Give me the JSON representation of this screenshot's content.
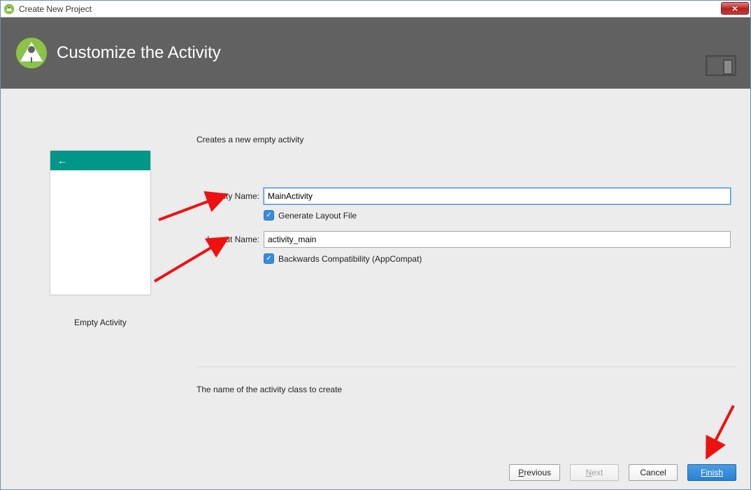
{
  "window": {
    "title": "Create New Project"
  },
  "banner": {
    "title": "Customize the Activity"
  },
  "preview": {
    "caption": "Empty Activity"
  },
  "form": {
    "intro": "Creates a new empty activity",
    "activity_label": "Activity Name:",
    "activity_value": "MainActivity",
    "generate_label": "Generate Layout File",
    "layout_label": "Layout Name:",
    "layout_value": "activity_main",
    "backcompat_label": "Backwards Compatibility (AppCompat)",
    "helper": "The name of the activity class to create"
  },
  "buttons": {
    "previous": "Previous",
    "next": "Next",
    "cancel": "Cancel",
    "finish": "Finish"
  },
  "icons": {
    "close": "✕",
    "check": "✓",
    "back_arrow": "←"
  }
}
